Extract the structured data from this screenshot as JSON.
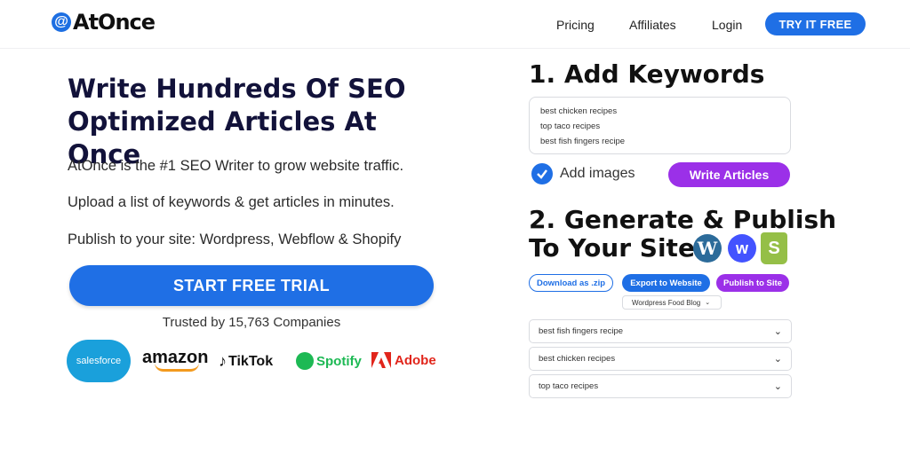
{
  "nav": {
    "logo_symbol": "@",
    "logo_text": "AtOnce",
    "links": [
      "Pricing",
      "Affiliates",
      "Login"
    ],
    "cta": "TRY IT FREE"
  },
  "hero": {
    "headline": "Write Hundreds Of SEO Optimized Articles At Once",
    "lines": [
      "AtOnce is the #1 SEO Writer to grow website traffic.",
      "Upload a list of keywords & get articles in minutes.",
      "Publish to your site: Wordpress, Webflow & Shopify"
    ],
    "cta": "START FREE TRIAL",
    "trusted": "Trusted by 15,763 Companies",
    "brands": [
      "salesforce",
      "amazon",
      "TikTok",
      "Spotify",
      "Adobe"
    ]
  },
  "step1": {
    "title": "1. Add Keywords",
    "keywords": [
      "best chicken recipes",
      "top taco recipes",
      "best fish fingers recipe"
    ],
    "checkbox_label": "Add images",
    "button": "Write Articles"
  },
  "step2": {
    "title_line1": "2. Generate & Publish",
    "title_line2": "To Your Site",
    "buttons": [
      "Download as .zip",
      "Export to Website",
      "Publish to Site"
    ],
    "site_select": "Wordpress Food Blog",
    "articles": [
      "best fish fingers recipe",
      "best chicken recipes",
      "top taco recipes"
    ]
  },
  "colors": {
    "primary": "#1f6fe5",
    "purple": "#9b30e8",
    "headline": "#12123a"
  }
}
